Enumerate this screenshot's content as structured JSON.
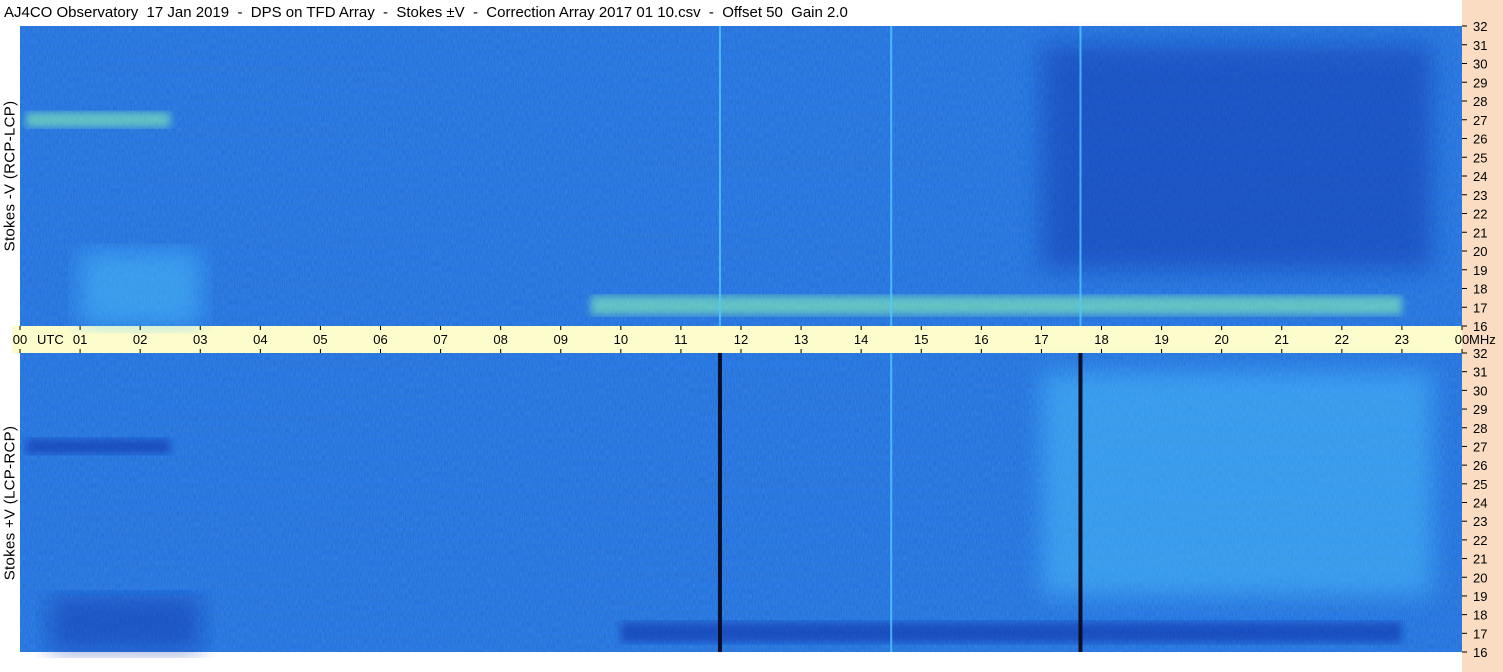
{
  "title": "AJ4CO Observatory  17 Jan 2019  -  DPS on TFD Array  -  Stokes ±V  -  Correction Array 2017 01 10.csv  -  Offset 50  Gain 2.0",
  "chart_data": [
    {
      "type": "heatmap",
      "panel": "top",
      "ylabel": "Stokes -V  (RCP-LCP)",
      "x_range": [
        "00",
        "00"
      ],
      "x_ticks": [
        "00",
        "01",
        "02",
        "03",
        "04",
        "05",
        "06",
        "07",
        "08",
        "09",
        "10",
        "11",
        "12",
        "13",
        "14",
        "15",
        "16",
        "17",
        "18",
        "19",
        "20",
        "21",
        "22",
        "23",
        "00"
      ],
      "x_label": "UTC",
      "y_ticks": [
        16,
        17,
        18,
        19,
        20,
        21,
        22,
        23,
        24,
        25,
        26,
        27,
        28,
        29,
        30,
        31,
        32
      ],
      "y_unit": "MHz",
      "ylim": [
        16,
        32
      ],
      "features": [
        {
          "kind": "bright-band",
          "t_start": 0.1,
          "t_end": 2.5,
          "f_low": 26.6,
          "f_high": 27.4
        },
        {
          "kind": "bright-patch",
          "t_start": 1.0,
          "t_end": 3.0,
          "f_low": 16,
          "f_high": 20
        },
        {
          "kind": "interference-band",
          "t_start": 9.5,
          "t_end": 23.0,
          "f_low": 16.6,
          "f_high": 17.6
        },
        {
          "kind": "dark-patch",
          "t_start": 17.0,
          "t_end": 23.5,
          "f_low": 19,
          "f_high": 31
        },
        {
          "kind": "vertical-line-bright",
          "t": 11.65
        },
        {
          "kind": "vertical-line-bright",
          "t": 14.5
        },
        {
          "kind": "vertical-line-bright",
          "t": 17.65
        }
      ]
    },
    {
      "type": "heatmap",
      "panel": "bottom",
      "ylabel": "Stokes +V  (LCP-RCP)",
      "x_range": [
        "00",
        "00"
      ],
      "x_ticks": [
        "00",
        "01",
        "02",
        "03",
        "04",
        "05",
        "06",
        "07",
        "08",
        "09",
        "10",
        "11",
        "12",
        "13",
        "14",
        "15",
        "16",
        "17",
        "18",
        "19",
        "20",
        "21",
        "22",
        "23",
        "00"
      ],
      "x_label": "UTC",
      "y_ticks": [
        16,
        17,
        18,
        19,
        20,
        21,
        22,
        23,
        24,
        25,
        26,
        27,
        28,
        29,
        30,
        31,
        32
      ],
      "y_unit": "MHz",
      "ylim": [
        16,
        32
      ],
      "features": [
        {
          "kind": "dark-band",
          "t_start": 0.1,
          "t_end": 2.5,
          "f_low": 26.6,
          "f_high": 27.4
        },
        {
          "kind": "dark-patch",
          "t_start": 0.5,
          "t_end": 3.0,
          "f_low": 16,
          "f_high": 19
        },
        {
          "kind": "interference-band-dark",
          "t_start": 10.0,
          "t_end": 23.0,
          "f_low": 16.5,
          "f_high": 17.6
        },
        {
          "kind": "bright-patch",
          "t_start": 17.0,
          "t_end": 23.5,
          "f_low": 19,
          "f_high": 31
        },
        {
          "kind": "vertical-line-dark",
          "t": 11.65
        },
        {
          "kind": "vertical-line-bright",
          "t": 14.5
        },
        {
          "kind": "vertical-line-dark",
          "t": 17.65
        }
      ]
    }
  ],
  "colors": {
    "base": "#1f6fe0",
    "dark": "#0a2fa8",
    "bright": "#4fc9ff",
    "hot": "#8fffb0",
    "axis_bg": "#fdfccc",
    "strip_bg": "#f9dcc2"
  }
}
